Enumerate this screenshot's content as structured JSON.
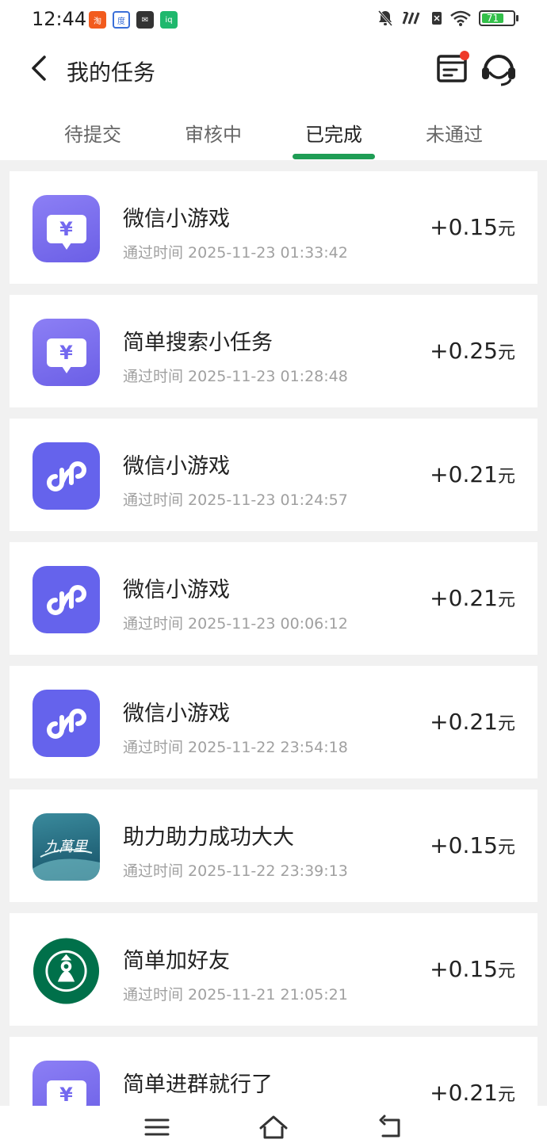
{
  "status_bar": {
    "time": "12:44",
    "battery_level": "71",
    "battery_fraction": 0.71,
    "icons": [
      "taobao-icon",
      "baidu-icon",
      "mail-icon",
      "iqiyi-icon",
      "mute-bell-icon",
      "signal-icon",
      "sim-icon",
      "wifi-icon",
      "battery-icon"
    ]
  },
  "header": {
    "title": "我的任务",
    "back_icon": "back-chevron-icon",
    "message_icon": "message-list-icon",
    "service_icon": "customer-service-icon"
  },
  "tabs": [
    {
      "label": "待提交",
      "active": false
    },
    {
      "label": "审核中",
      "active": false
    },
    {
      "label": "已完成",
      "active": true
    },
    {
      "label": "未通过",
      "active": false
    }
  ],
  "colors": {
    "accent": "#1f9d55",
    "badge": "#ee3a2a",
    "task_icon_purple": "#7368ef",
    "time_gray": "#a0a0a0"
  },
  "tasks": [
    {
      "icon": "yuan-icon",
      "title": "微信小游戏",
      "time": "通过时间 2025-11-23 01:33:42",
      "amount": "+0.15",
      "unit": "元"
    },
    {
      "icon": "yuan-icon",
      "title": "简单搜索小任务",
      "time": "通过时间 2025-11-23 01:28:48",
      "amount": "+0.25",
      "unit": "元"
    },
    {
      "icon": "mini-program-icon",
      "title": "微信小游戏",
      "time": "通过时间 2025-11-23 01:24:57",
      "amount": "+0.21",
      "unit": "元"
    },
    {
      "icon": "mini-program-icon",
      "title": "微信小游戏",
      "time": "通过时间 2025-11-23 00:06:12",
      "amount": "+0.21",
      "unit": "元"
    },
    {
      "icon": "mini-program-icon",
      "title": "微信小游戏",
      "time": "通过时间 2025-11-22 23:54:18",
      "amount": "+0.21",
      "unit": "元"
    },
    {
      "icon": "jiuwanli-logo",
      "title": "助力助力成功大大",
      "time": "通过时间 2025-11-22 23:39:13",
      "amount": "+0.15",
      "unit": "元"
    },
    {
      "icon": "starbucks-logo",
      "title": "简单加好友",
      "time": "通过时间 2025-11-21 21:05:21",
      "amount": "+0.15",
      "unit": "元"
    },
    {
      "icon": "yuan-icon",
      "title": "简单进群就行了",
      "time": "",
      "amount": "+0.21",
      "unit": "元"
    }
  ],
  "nav": {
    "menu_icon": "menu-icon",
    "home_icon": "home-icon",
    "back_icon": "back-return-icon"
  }
}
